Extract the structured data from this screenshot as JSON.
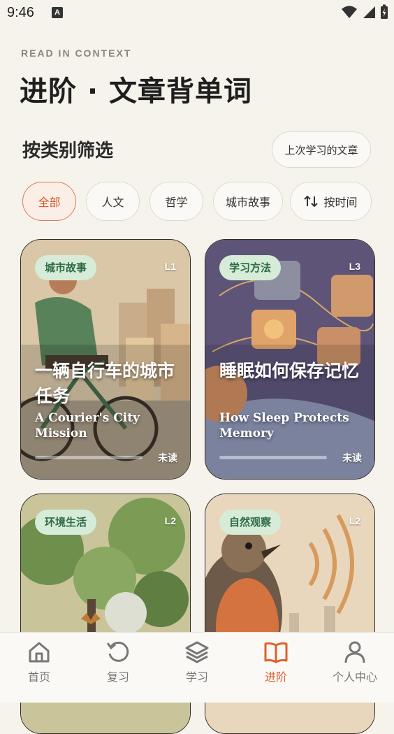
{
  "status_bar": {
    "time": "9:46",
    "notification_icon": "A"
  },
  "header": {
    "eyebrow": "READ IN CONTEXT",
    "title": "进阶 · 文章背单词"
  },
  "filter": {
    "section_title": "按类别筛选",
    "last_studied_button": "上次学习的文章",
    "chips": [
      "全部",
      "人文",
      "哲学",
      "城市故事"
    ],
    "active_chip": "全部",
    "sort_button": "按时间"
  },
  "articles": [
    {
      "tag": "城市故事",
      "level": "L1",
      "title_zh": "一辆自行车的城市任务",
      "title_en": "A Courier's City Mission",
      "status": "未读",
      "progress": 0
    },
    {
      "tag": "学习方法",
      "level": "L3",
      "title_zh": "睡眠如何保存记忆",
      "title_en": "How Sleep Protects Memory",
      "status": "未读",
      "progress": 0
    },
    {
      "tag": "环境生活",
      "level": "L2"
    },
    {
      "tag": "自然观察",
      "level": "L2"
    }
  ],
  "bottom_nav": {
    "items": [
      {
        "label": "首页",
        "icon": "home-icon"
      },
      {
        "label": "复习",
        "icon": "review-icon"
      },
      {
        "label": "学习",
        "icon": "layers-icon"
      },
      {
        "label": "进阶",
        "icon": "book-icon"
      },
      {
        "label": "个人中心",
        "icon": "person-icon"
      }
    ],
    "active": "进阶"
  },
  "colors": {
    "accent": "#e0602e",
    "tag_bg": "#d6ecd9",
    "tag_text": "#2f6a45",
    "background": "#f6f2ec"
  }
}
